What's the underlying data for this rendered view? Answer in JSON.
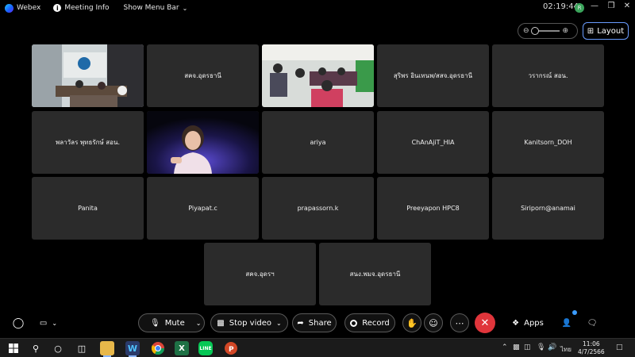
{
  "titlebar": {
    "app_name": "Webex",
    "meeting_info": "Meeting Info",
    "menu_bar": "Show Menu Bar",
    "time": "02:19:44",
    "avatar_initials": "R"
  },
  "layout_button": "Layout",
  "tiles": [
    {
      "name": "",
      "video": true
    },
    {
      "name": "สคจ.อุดรธานี",
      "video": false
    },
    {
      "name": "",
      "video": true
    },
    {
      "name": "สุริพร อินเทนพ/สสจ.อุดรธานี",
      "video": false
    },
    {
      "name": "วรากรณ์ สอน.",
      "video": false
    },
    {
      "name": "พลาวัลร พุทธรักษ์ สอน.",
      "video": false
    },
    {
      "name": "",
      "video": true
    },
    {
      "name": "ariya",
      "video": false
    },
    {
      "name": "ChAnAjiT_HIA",
      "video": false
    },
    {
      "name": "Kanitsorn_DOH",
      "video": false
    },
    {
      "name": "Panita",
      "video": false
    },
    {
      "name": "Piyapat.c",
      "video": false
    },
    {
      "name": "prapassorn.k",
      "video": false
    },
    {
      "name": "Preeyapon HPC8",
      "video": false
    },
    {
      "name": "Siriporn@anamai",
      "video": false
    },
    {
      "name": "สคจ.อุดรฯ",
      "video": false
    },
    {
      "name": "สนง.พมจ.อุดรธานี",
      "video": false
    }
  ],
  "controls": {
    "mute": "Mute",
    "stop_video": "Stop video",
    "share": "Share",
    "record": "Record",
    "apps": "Apps"
  },
  "taskbar": {
    "lang": "ไทย",
    "time": "11:06",
    "date": "4/7/2566"
  },
  "colors": {
    "end_call": "#e0353b",
    "layout_border": "#6a9cff",
    "tile_bg": "#2b2b2b"
  }
}
